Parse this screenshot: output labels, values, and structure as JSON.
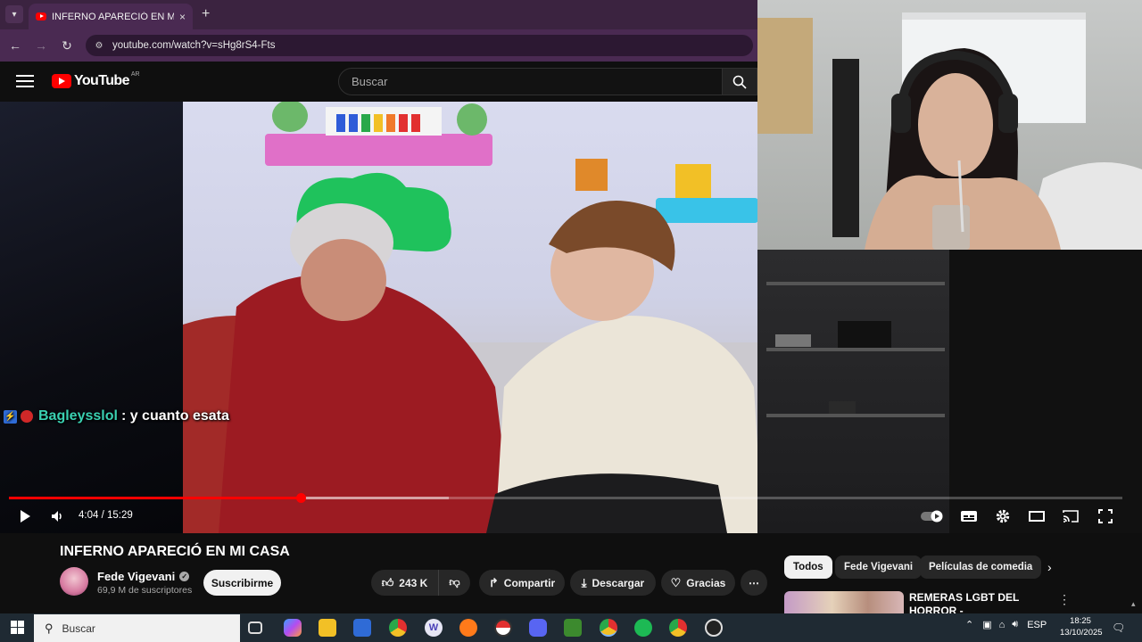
{
  "browser": {
    "tab_title": "INFERNO APARECIÓ EN MI CASA - YouTube",
    "url": "youtube.com/watch?v=sHg8rS4-Fts",
    "new_tab_glyph": "+",
    "close_glyph": "×"
  },
  "youtube_header": {
    "logo_text": "YouTube",
    "country_code": "AR",
    "search_placeholder": "Buscar"
  },
  "chat_overlay": {
    "username": "Bagleysslol",
    "message": ": y cuanto esata"
  },
  "player": {
    "current_time": "4:04",
    "duration": "15:29",
    "time_text": "4:04 / 15:29",
    "played_fraction": 0.262,
    "buffered_fraction": 0.395,
    "accent_color": "#ff0000"
  },
  "video": {
    "title": "INFERNO APARECIÓ EN MI CASA",
    "channel_name": "Fede Vigevani",
    "subscribers": "69,9 M de suscriptores",
    "subscribe_label": "Suscribirme",
    "likes": "243 K",
    "share_label": "Compartir",
    "download_label": "Descargar",
    "thanks_label": "Gracias",
    "more_label": "⋯"
  },
  "filter_chips": [
    "Todos",
    "Fede Vigevani",
    "Películas de comedia"
  ],
  "recommendation": {
    "title": "REMERAS LGBT DEL HORROR - Emprendimientos by Nerea"
  },
  "taskbar": {
    "search_placeholder": "Buscar",
    "language": "ESP",
    "time": "18:25",
    "date": "13/10/2025",
    "icons": [
      "task-view-icon",
      "copilot-icon",
      "file-explorer-icon",
      "store-icon",
      "chrome-icon",
      "word-icon",
      "spark-icon",
      "pokeball-icon",
      "discord-icon",
      "minecraft-icon",
      "chrome-active-icon",
      "spotify-icon",
      "chrome-profile-icon",
      "obs-icon"
    ]
  }
}
